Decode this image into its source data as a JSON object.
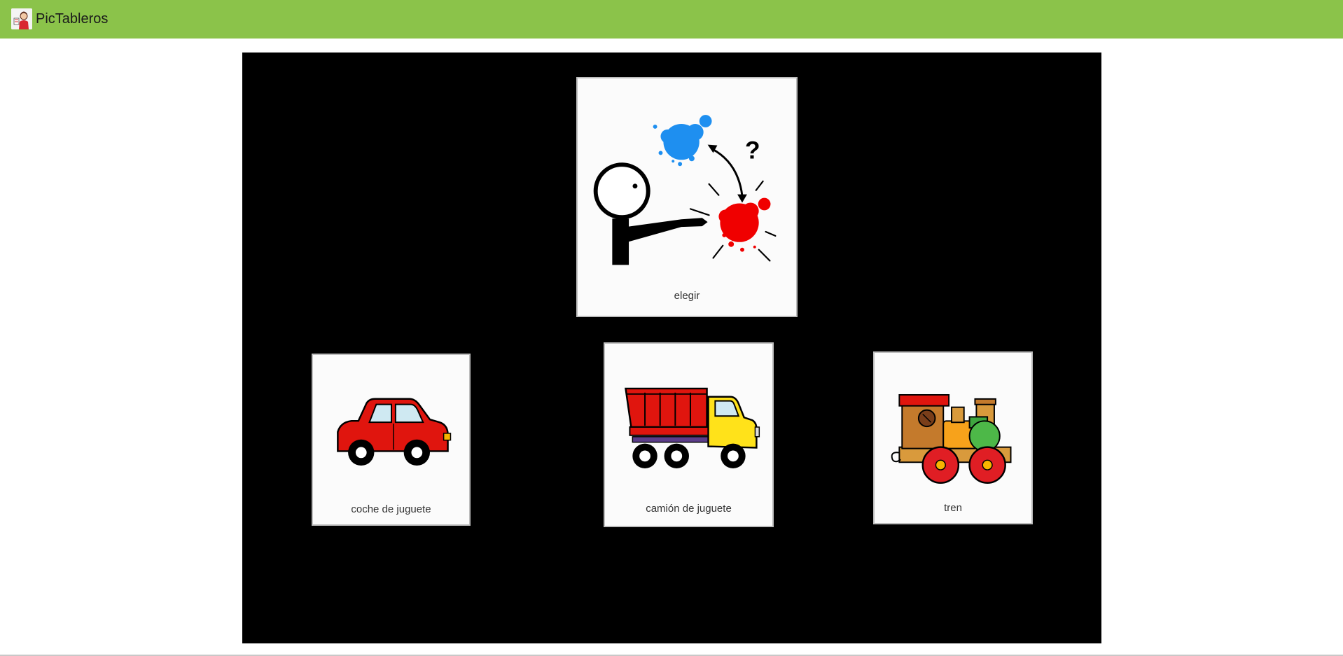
{
  "app": {
    "title": "PicTableros",
    "header_color": "#8bc34a"
  },
  "board": {
    "background": "#000000",
    "cards": [
      {
        "id": "elegir",
        "label": "elegir",
        "icon": "choose-pictogram-icon"
      },
      {
        "id": "coche",
        "label": "coche de juguete",
        "icon": "toy-car-icon"
      },
      {
        "id": "camion",
        "label": "camión de juguete",
        "icon": "toy-truck-icon"
      },
      {
        "id": "tren",
        "label": "tren",
        "icon": "toy-train-icon"
      }
    ]
  }
}
